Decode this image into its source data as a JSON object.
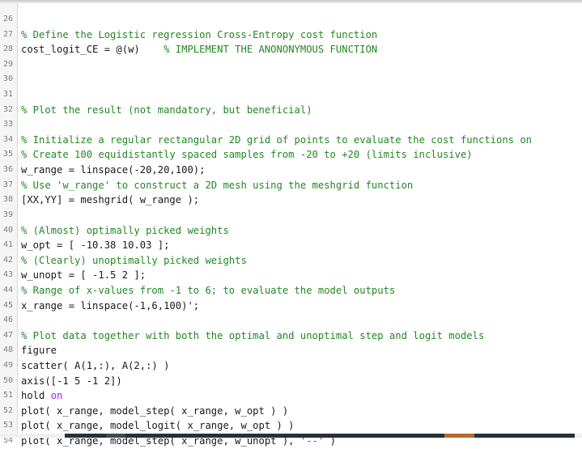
{
  "editor": {
    "lines": [
      {
        "num": "26",
        "code": "",
        "comment": ""
      },
      {
        "num": "27",
        "code": "",
        "comment": "% Define the Logistic regression Cross-Entropy cost function"
      },
      {
        "num": "28",
        "code": "cost_logit_CE = @(w)    ",
        "comment": "% IMPLEMENT THE ANONONYMOUS FUNCTION"
      },
      {
        "num": "29",
        "code": "",
        "comment": ""
      },
      {
        "num": "30",
        "code": "",
        "comment": ""
      },
      {
        "num": "31",
        "code": "",
        "comment": ""
      },
      {
        "num": "32",
        "code": "",
        "comment": "% Plot the result (not mandatory, but beneficial)"
      },
      {
        "num": "33",
        "code": "",
        "comment": ""
      },
      {
        "num": "34",
        "code": "",
        "comment": "% Initialize a regular rectangular 2D grid of points to evaluate the cost functions on"
      },
      {
        "num": "35",
        "code": "",
        "comment": "% Create 100 equidistantly spaced samples from -20 to +20 (limits inclusive)"
      },
      {
        "num": "36",
        "code": "w_range = linspace(-20,20,100);",
        "comment": ""
      },
      {
        "num": "37",
        "code": "",
        "comment": "% Use 'w_range' to construct a 2D mesh using the meshgrid function"
      },
      {
        "num": "38",
        "code": "[XX,YY] = meshgrid( w_range );",
        "comment": ""
      },
      {
        "num": "39",
        "code": "",
        "comment": ""
      },
      {
        "num": "40",
        "code": "",
        "comment": "% (Almost) optimally picked weights"
      },
      {
        "num": "41",
        "code": "w_opt = [ -10.38 10.03 ];",
        "comment": ""
      },
      {
        "num": "42",
        "code": "",
        "comment": "% (Clearly) unoptimally picked weights"
      },
      {
        "num": "43",
        "code": "w_unopt = [ -1.5 2 ];",
        "comment": ""
      },
      {
        "num": "44",
        "code": "",
        "comment": "% Range of x-values from -1 to 6; to evaluate the model outputs"
      },
      {
        "num": "45",
        "code": "x_range = linspace(-1,6,100)';",
        "comment": ""
      },
      {
        "num": "46",
        "code": "",
        "comment": ""
      },
      {
        "num": "47",
        "code": "",
        "comment": "% Plot data together with both the optimal and unoptimal step and logit models"
      },
      {
        "num": "48",
        "code": "figure",
        "comment": ""
      },
      {
        "num": "49",
        "code": "scatter( A(1,:), A(2,:) )",
        "comment": ""
      },
      {
        "num": "50",
        "code": "axis([-1 5 -1 2])",
        "comment": ""
      },
      {
        "num": "51",
        "code": "hold ",
        "keyword": "on",
        "comment": ""
      },
      {
        "num": "52",
        "code": "plot( x_range, model_step( x_range, w_opt ) )",
        "comment": ""
      },
      {
        "num": "53",
        "code": "plot( x_range, model_logit( x_range, w_opt ) )",
        "comment": ""
      },
      {
        "num": "54",
        "code": "plot( x_range, model_step( x_range, w_unopt ), ",
        "string": "'--'",
        "tail": " )",
        "comment": ""
      }
    ]
  }
}
